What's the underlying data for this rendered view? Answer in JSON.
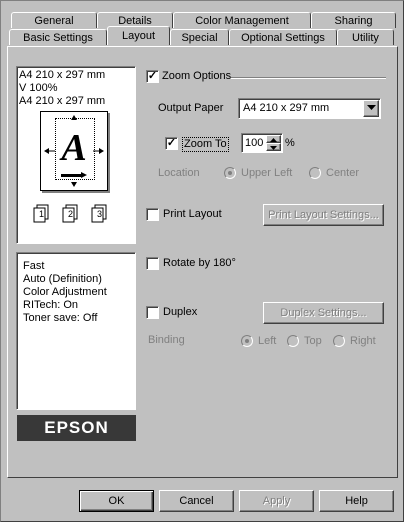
{
  "tabs_back": [
    {
      "label": "General"
    },
    {
      "label": "Details"
    },
    {
      "label": "Color Management"
    },
    {
      "label": "Sharing"
    }
  ],
  "tabs_front": [
    {
      "label": "Basic Settings"
    },
    {
      "label": "Layout"
    },
    {
      "label": "Special"
    },
    {
      "label": "Optional Settings"
    },
    {
      "label": "Utility"
    }
  ],
  "preview": {
    "lines": [
      "A4 210 x 297 mm",
      "V 100%",
      "A4 210 x 297 mm"
    ],
    "page_letter": "A",
    "copy_numbers": [
      "1",
      "2",
      "3"
    ]
  },
  "summary": {
    "lines": [
      "Fast",
      "Auto (Definition)",
      "Color Adjustment",
      "RITech: On",
      "Toner save: Off"
    ]
  },
  "brand": "EPSON",
  "zoom_options": {
    "label": "Zoom Options",
    "checked": true,
    "output_paper_label": "Output Paper",
    "output_paper_value": "A4 210 x 297 mm",
    "zoom_to_label": "Zoom To",
    "zoom_to_checked": true,
    "zoom_value": "100",
    "percent": "%",
    "location_label": "Location",
    "location_upper_left": "Upper Left",
    "location_center": "Center"
  },
  "print_layout": {
    "label": "Print Layout",
    "checked": false,
    "settings_button": "Print Layout Settings..."
  },
  "rotate": {
    "label": "Rotate by 180°",
    "checked": false
  },
  "duplex": {
    "label": "Duplex",
    "checked": false,
    "settings_button": "Duplex Settings...",
    "binding_label": "Binding",
    "binding_left": "Left",
    "binding_top": "Top",
    "binding_right": "Right"
  },
  "footer": {
    "ok": "OK",
    "cancel": "Cancel",
    "apply": "Apply",
    "help": "Help"
  }
}
